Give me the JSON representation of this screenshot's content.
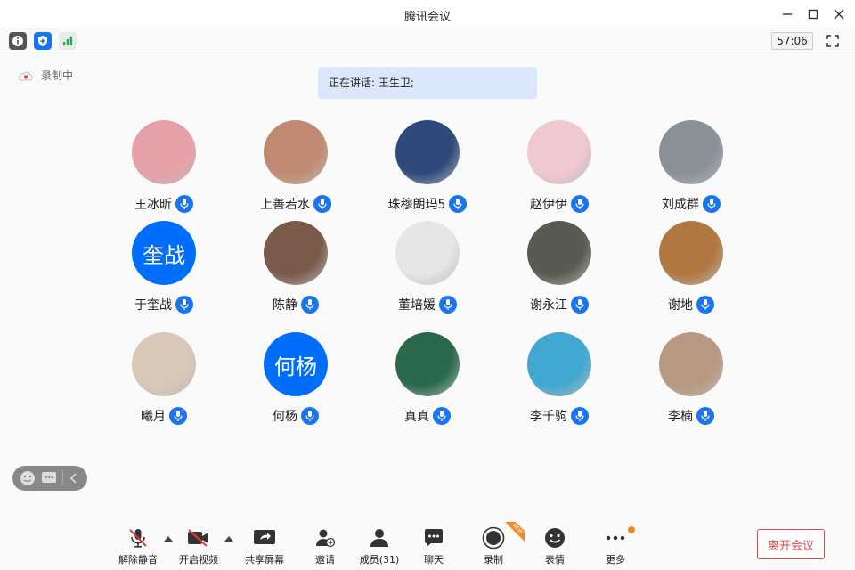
{
  "window": {
    "title": "腾讯会议",
    "minimize": "–",
    "maximize": "☐",
    "close": "✕"
  },
  "infobar": {
    "timer": "57:06",
    "icons": [
      "info-icon",
      "shield-icon",
      "signal-icon",
      "fullscreen-icon"
    ]
  },
  "recording": {
    "label": "录制中"
  },
  "speaking": {
    "text": "正在讲话: 王生卫;"
  },
  "participants": [
    {
      "name": "王冰昕",
      "avatar_text": "",
      "color": "#e8a0a8"
    },
    {
      "name": "上善若水",
      "avatar_text": "",
      "color": "#c08a70"
    },
    {
      "name": "珠穆朗玛5",
      "avatar_text": "",
      "color": "#2e4a7a"
    },
    {
      "name": "赵伊伊",
      "avatar_text": "",
      "color": "#f0c8d0"
    },
    {
      "name": "刘成群",
      "avatar_text": "",
      "color": "#8a9098"
    },
    {
      "name": "于奎战",
      "avatar_text": "奎战",
      "color": "#006efa"
    },
    {
      "name": "陈静",
      "avatar_text": "",
      "color": "#7a5a4a"
    },
    {
      "name": "董培媛",
      "avatar_text": "",
      "color": "#e6e6e6"
    },
    {
      "name": "谢永江",
      "avatar_text": "",
      "color": "#5a5a50"
    },
    {
      "name": "谢地",
      "avatar_text": "",
      "color": "#b07840"
    },
    {
      "name": "曦月",
      "avatar_text": "",
      "color": "#d8c8b8"
    },
    {
      "name": "何杨",
      "avatar_text": "何杨",
      "color": "#006efa"
    },
    {
      "name": "真真",
      "avatar_text": "",
      "color": "#2a6a4a"
    },
    {
      "name": "李千驹",
      "avatar_text": "",
      "color": "#40a8d0"
    },
    {
      "name": "李楠",
      "avatar_text": "",
      "color": "#b89880"
    }
  ],
  "toolbar": {
    "unmute": "解除静音",
    "video": "开启视频",
    "share": "共享屏幕",
    "invite": "邀请",
    "members": "成员(31)",
    "chat": "聊天",
    "record": "录制",
    "emoji": "表情",
    "more": "更多",
    "new_badge": "NEW",
    "leave": "离开会议"
  },
  "colors": {
    "accent": "#1a74f0",
    "leave": "#e04a4a",
    "badge": "#f08a24"
  }
}
